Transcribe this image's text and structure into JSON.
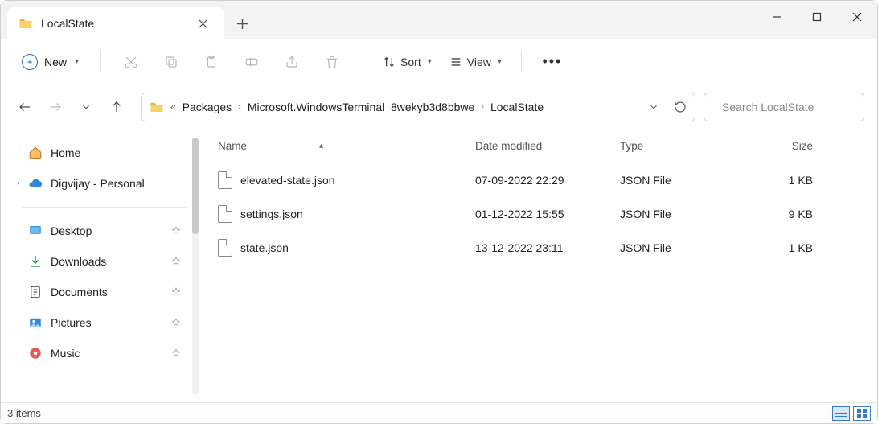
{
  "tab": {
    "title": "LocalState"
  },
  "toolbar": {
    "new_label": "New",
    "sort_label": "Sort",
    "view_label": "View"
  },
  "breadcrumb": {
    "seg1": "Packages",
    "seg2": "Microsoft.WindowsTerminal_8wekyb3d8bbwe",
    "seg3": "LocalState"
  },
  "search": {
    "placeholder": "Search LocalState"
  },
  "sidebar": {
    "home": "Home",
    "cloud": "Digvijay - Personal",
    "quick": {
      "desktop": "Desktop",
      "downloads": "Downloads",
      "documents": "Documents",
      "pictures": "Pictures",
      "music": "Music"
    }
  },
  "columns": {
    "name": "Name",
    "date": "Date modified",
    "type": "Type",
    "size": "Size"
  },
  "files": [
    {
      "name": "elevated-state.json",
      "date": "07-09-2022 22:29",
      "type": "JSON File",
      "size": "1 KB"
    },
    {
      "name": "settings.json",
      "date": "01-12-2022 15:55",
      "type": "JSON File",
      "size": "9 KB"
    },
    {
      "name": "state.json",
      "date": "13-12-2022 23:11",
      "type": "JSON File",
      "size": "1 KB"
    }
  ],
  "status": {
    "count": "3 items"
  }
}
